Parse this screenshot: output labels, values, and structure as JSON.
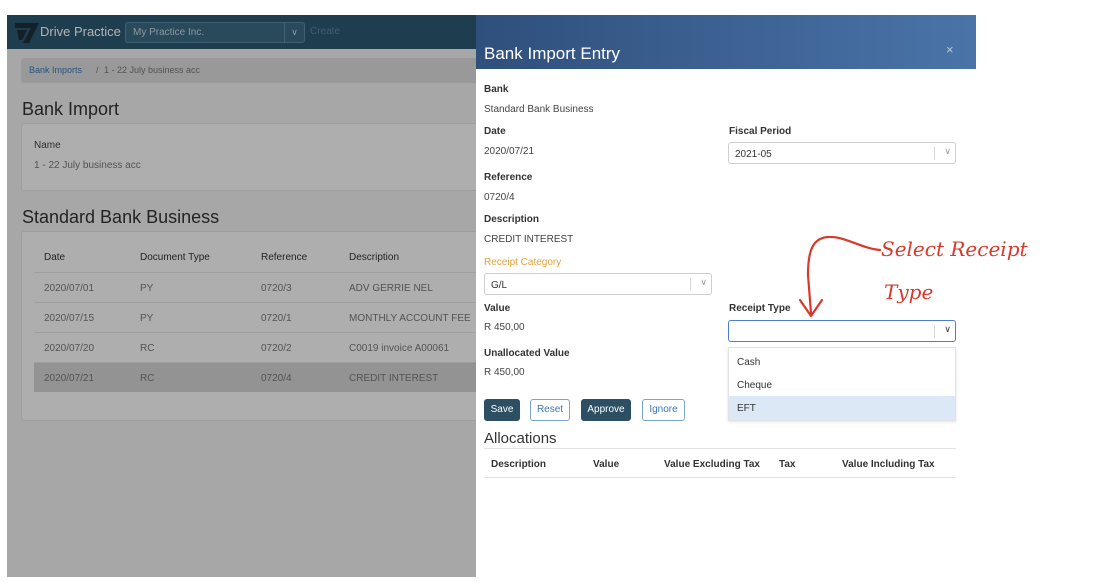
{
  "app": {
    "brand": "Drive Practice",
    "company_selected": "My Practice Inc.",
    "create_label": "Create",
    "breadcrumb": {
      "link": "Bank Imports",
      "separator": "/",
      "current": "1 - 22 July business acc"
    },
    "page_title": "Bank Import",
    "name_label": "Name",
    "name_value": "1 - 22 July business acc",
    "section_title": "Standard Bank Business",
    "table": {
      "columns": [
        "Date",
        "Document Type",
        "Reference",
        "Description"
      ],
      "rows": [
        [
          "2020/07/01",
          "PY",
          "0720/3",
          "ADV GERRIE NEL"
        ],
        [
          "2020/07/15",
          "PY",
          "0720/1",
          "MONTHLY ACCOUNT FEE"
        ],
        [
          "2020/07/20",
          "RC",
          "0720/2",
          "C0019 invoice A00061"
        ],
        [
          "2020/07/21",
          "RC",
          "0720/4",
          "CREDIT INTEREST"
        ]
      ]
    }
  },
  "modal": {
    "title": "Bank Import Entry",
    "close_icon": "×",
    "bank_label": "Bank",
    "bank_value": "Standard Bank Business",
    "date_label": "Date",
    "date_value": "2020/07/21",
    "fiscal_label": "Fiscal Period",
    "fiscal_value": "2021-05",
    "reference_label": "Reference",
    "reference_value": "0720/4",
    "description_label": "Description",
    "description_value": "CREDIT INTEREST",
    "receipt_category_label": "Receipt Category",
    "receipt_category_value": "G/L",
    "value_label": "Value",
    "value_value": "R 450,00",
    "receipt_type_label": "Receipt Type",
    "receipt_type_value": "",
    "receipt_type_options": [
      "Cash",
      "Cheque",
      "EFT"
    ],
    "unallocated_label": "Unallocated Value",
    "unallocated_value": "R 450,00",
    "buttons": {
      "save": "Save",
      "reset": "Reset",
      "approve": "Approve",
      "ignore": "Ignore"
    },
    "allocations_title": "Allocations",
    "allocations_columns": [
      "Description",
      "Value",
      "Value Excluding Tax",
      "Tax",
      "Value Including Tax"
    ]
  },
  "annotation": {
    "line1": "Select Receipt",
    "line2": "Type",
    "color": "#d8392c"
  },
  "icons": {
    "chevron": "chevron-down-icon",
    "close": "close-icon",
    "logo": "logo-icon"
  }
}
